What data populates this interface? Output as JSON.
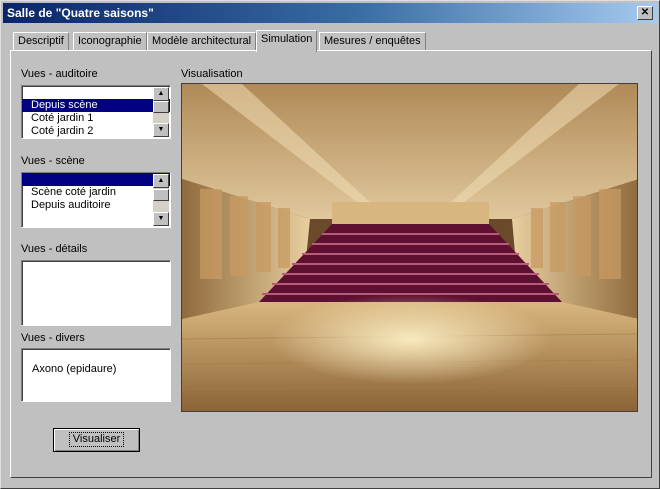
{
  "window": {
    "title": "Salle de \"Quatre saisons\"",
    "close_glyph": "✕"
  },
  "tabs": [
    {
      "label": "Descriptif",
      "active": false
    },
    {
      "label": "Iconographie",
      "active": false
    },
    {
      "label": "Modèle architectural",
      "active": false
    },
    {
      "label": "Simulation",
      "active": true
    },
    {
      "label": "Mesures / enquêtes",
      "active": false
    }
  ],
  "groups": {
    "auditoire": {
      "label": "Vues - auditoire",
      "items": [
        "",
        "Depuis scène",
        "Coté jardin 1",
        "Coté jardin 2"
      ],
      "selected_index": 1
    },
    "scene": {
      "label": "Vues - scène",
      "items": [
        "",
        "Scène coté jardin",
        "Depuis auditoire"
      ],
      "selected_index": 0
    },
    "details": {
      "label": "Vues - détails",
      "items": []
    },
    "divers": {
      "label": "Vues - divers",
      "items": [
        "Axono (epidaure)"
      ]
    }
  },
  "visualisation": {
    "label": "Visualisation",
    "image_subject": "rendered auditorium interior viewed from stage"
  },
  "buttons": {
    "visualiser": "Visualiser"
  },
  "colors": {
    "selection": "#000080",
    "face": "#c0c0c0",
    "title_start": "#0a246a",
    "title_end": "#a6caf0"
  },
  "icons": {
    "scroll_up": "▲",
    "scroll_down": "▼"
  }
}
